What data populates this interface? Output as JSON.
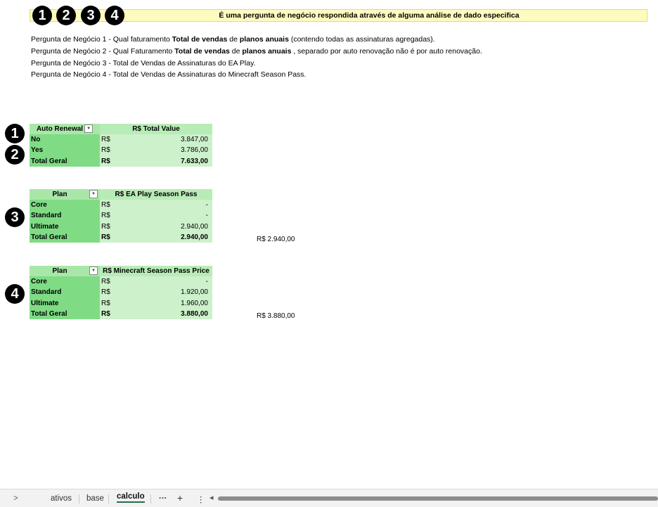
{
  "banner": {
    "badges": [
      "1",
      "2",
      "3",
      "4"
    ],
    "text": "É uma pergunta de negócio respondida através de alguma análise de dado especifica"
  },
  "questions": {
    "q1": {
      "a": "Pergunta de Negócio 1 - Qual faturamento ",
      "b1": "Total de vendas",
      "c": " de ",
      "b2": "planos anuais",
      "d": " (contendo todas as assinaturas agregadas)."
    },
    "q2": {
      "a": "Pergunta de Negócio 2 - Qual Faturamento ",
      "b1": "Total de vendas",
      "c": " de ",
      "b2": "planos anuais",
      "d": " , separado por auto renovação não é por auto renovação."
    },
    "q3": "Pergunta de Negócio 3 - Total de Vendas de Assinaturas do EA Play.",
    "q4": "Pergunta de Negócio 4 - Total de Vendas de Assinaturas do Minecraft Season Pass."
  },
  "side_badges": [
    "1",
    "2",
    "3",
    "4"
  ],
  "pivot1": {
    "header": [
      "Auto Renewal",
      "R$ Total Value"
    ],
    "rows": [
      {
        "label": "No",
        "cur": "R$",
        "value": "3.847,00"
      },
      {
        "label": "Yes",
        "cur": "R$",
        "value": "3.786,00"
      },
      {
        "label": "Total Geral",
        "cur": "R$",
        "value": "7.633,00"
      }
    ]
  },
  "pivot2": {
    "header": [
      "Plan",
      "R$ EA Play Season Pass"
    ],
    "rows": [
      {
        "label": "Core",
        "cur": "R$",
        "value": "-"
      },
      {
        "label": "Standard",
        "cur": "R$",
        "value": "-"
      },
      {
        "label": "Ultimate",
        "cur": "R$",
        "value": "2.940,00"
      },
      {
        "label": "Total Geral",
        "cur": "R$",
        "value": "2.940,00"
      }
    ],
    "side_total": "R$ 2.940,00"
  },
  "pivot3": {
    "header": [
      "Plan",
      "R$ Minecraft Season Pass Price"
    ],
    "rows": [
      {
        "label": "Core",
        "cur": "R$",
        "value": "-"
      },
      {
        "label": "Standard",
        "cur": "R$",
        "value": "1.920,00"
      },
      {
        "label": "Ultimate",
        "cur": "R$",
        "value": "1.960,00"
      },
      {
        "label": "Total Geral",
        "cur": "R$",
        "value": "3.880,00"
      }
    ],
    "side_total": "R$ 3.880,00"
  },
  "sheet_tabs": {
    "nav": ">",
    "tabs": [
      "ativos",
      "base",
      "calculo"
    ],
    "active": "calculo",
    "more": "···",
    "add": "+",
    "menu": "⋮",
    "scroll_left": "◂"
  },
  "colors": {
    "banner_bg": "#fefbbf",
    "pivot_header": "#a9e7a8",
    "pivot_row_label": "#7fdc85",
    "pivot_value": "#cdf1cb"
  }
}
